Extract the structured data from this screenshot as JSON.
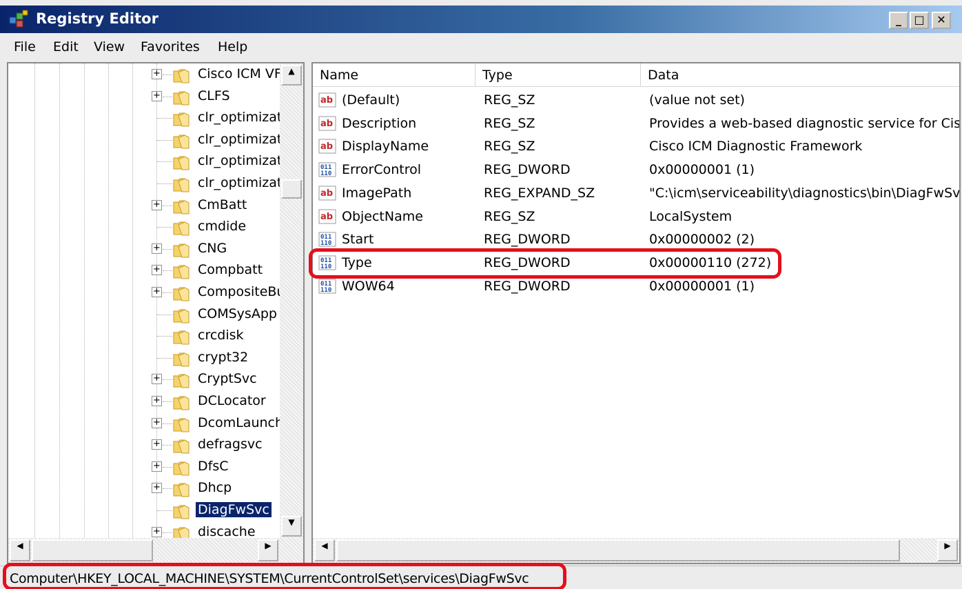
{
  "window": {
    "title": "Registry Editor"
  },
  "menu": [
    "File",
    "Edit",
    "View",
    "Favorites",
    "Help"
  ],
  "tree": {
    "items": [
      {
        "label": "Cisco ICM VF",
        "expandable": true
      },
      {
        "label": "CLFS",
        "expandable": true
      },
      {
        "label": "clr_optimizat",
        "expandable": false
      },
      {
        "label": "clr_optimizat",
        "expandable": false
      },
      {
        "label": "clr_optimizat",
        "expandable": false
      },
      {
        "label": "clr_optimizat",
        "expandable": false
      },
      {
        "label": "CmBatt",
        "expandable": true
      },
      {
        "label": "cmdide",
        "expandable": false
      },
      {
        "label": "CNG",
        "expandable": true
      },
      {
        "label": "Compbatt",
        "expandable": true
      },
      {
        "label": "CompositeBu",
        "expandable": true
      },
      {
        "label": "COMSysApp",
        "expandable": false
      },
      {
        "label": "crcdisk",
        "expandable": false
      },
      {
        "label": "crypt32",
        "expandable": false
      },
      {
        "label": "CryptSvc",
        "expandable": true
      },
      {
        "label": "DCLocator",
        "expandable": true
      },
      {
        "label": "DcomLaunch",
        "expandable": true
      },
      {
        "label": "defragsvc",
        "expandable": true
      },
      {
        "label": "DfsC",
        "expandable": true
      },
      {
        "label": "Dhcp",
        "expandable": true
      },
      {
        "label": "DiagFwSvc",
        "expandable": false,
        "selected": true
      },
      {
        "label": "discache",
        "expandable": true
      }
    ]
  },
  "list": {
    "columns": [
      "Name",
      "Type",
      "Data"
    ],
    "rows": [
      {
        "icon": "string-value-icon",
        "name": "(Default)",
        "type": "REG_SZ",
        "data": "(value not set)"
      },
      {
        "icon": "string-value-icon",
        "name": "Description",
        "type": "REG_SZ",
        "data": "Provides a web-based diagnostic service for Cis"
      },
      {
        "icon": "string-value-icon",
        "name": "DisplayName",
        "type": "REG_SZ",
        "data": "Cisco ICM Diagnostic Framework"
      },
      {
        "icon": "binary-value-icon",
        "name": "ErrorControl",
        "type": "REG_DWORD",
        "data": "0x00000001 (1)"
      },
      {
        "icon": "string-value-icon",
        "name": "ImagePath",
        "type": "REG_EXPAND_SZ",
        "data": "\"C:\\icm\\serviceability\\diagnostics\\bin\\DiagFwSv"
      },
      {
        "icon": "string-value-icon",
        "name": "ObjectName",
        "type": "REG_SZ",
        "data": "LocalSystem"
      },
      {
        "icon": "binary-value-icon",
        "name": "Start",
        "type": "REG_DWORD",
        "data": "0x00000002 (2)"
      },
      {
        "icon": "binary-value-icon",
        "name": "Type",
        "type": "REG_DWORD",
        "data": "0x00000110 (272)"
      },
      {
        "icon": "binary-value-icon",
        "name": "WOW64",
        "type": "REG_DWORD",
        "data": "0x00000001 (1)"
      }
    ]
  },
  "status": {
    "path": "Computer\\HKEY_LOCAL_MACHINE\\SYSTEM\\CurrentControlSet\\services\\DiagFwSvc"
  },
  "colors": {
    "highlight": "#e3101b",
    "selection": "#0a246a",
    "folder": "#f5d26b"
  }
}
